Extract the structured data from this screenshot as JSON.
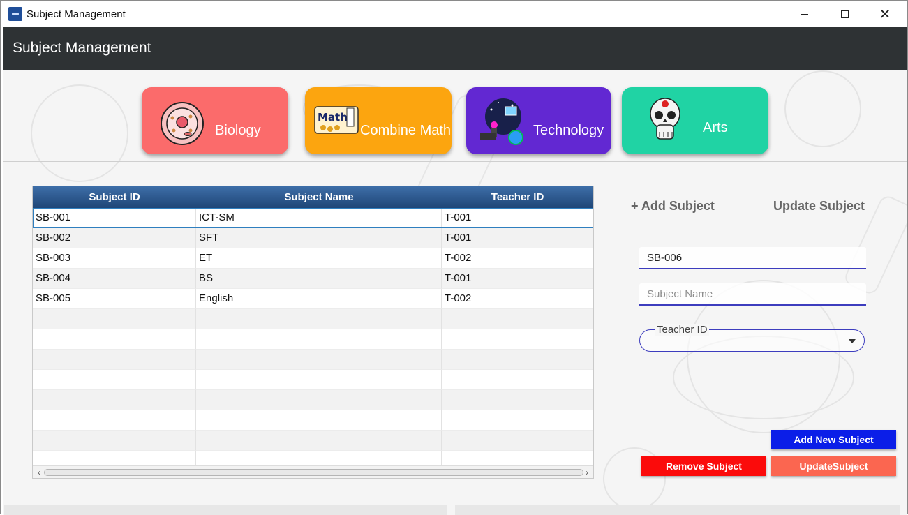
{
  "window": {
    "title": "Subject Management"
  },
  "header": {
    "title": "Subject Management"
  },
  "cards": [
    {
      "label": "Biology",
      "color": "#fb6b6b",
      "icon": "cell-icon"
    },
    {
      "label": "Combine Math",
      "color": "#fca50f",
      "icon": "math-icon"
    },
    {
      "label": "Technology",
      "color": "#6228d2",
      "icon": "technology-icon"
    },
    {
      "label": "Arts",
      "color": "#20d3a4",
      "icon": "skull-icon"
    }
  ],
  "table": {
    "columns": [
      "Subject ID",
      "Subject Name",
      "Teacher ID"
    ],
    "rows": [
      [
        "SB-001",
        "ICT-SM",
        "T-001"
      ],
      [
        "SB-002",
        "SFT",
        "T-001"
      ],
      [
        "SB-003",
        "ET",
        "T-002"
      ],
      [
        "SB-004",
        "BS",
        "T-001"
      ],
      [
        "SB-005",
        "English",
        "T-002"
      ]
    ],
    "selected_row": 0
  },
  "form": {
    "tab_add": "+ Add Subject",
    "tab_update": "Update Subject",
    "subject_id_value": "SB-006",
    "subject_name_placeholder": "Subject Name",
    "teacher_id_label": "Teacher ID"
  },
  "buttons": {
    "add": "Add New Subject",
    "remove": "Remove Subject",
    "update": "UpdateSubject"
  },
  "colors": {
    "header": "#2e3234",
    "table_header": "#2a5a91",
    "add_button": "#0b1ee8",
    "remove_button": "#fb0b0b",
    "update_button": "#fb6650",
    "field_underline": "#3d3dbe"
  }
}
